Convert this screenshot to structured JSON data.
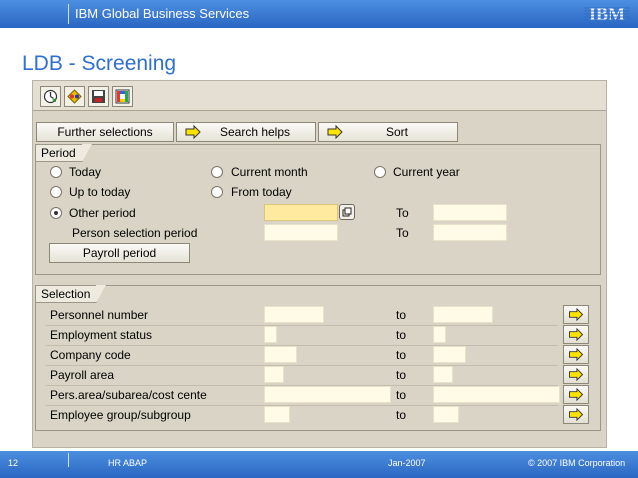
{
  "header": {
    "company": "IBM Global Business Services",
    "logo_text": "IBM"
  },
  "slide_title": "LDB - Screening",
  "toolbar": {
    "icons": [
      "execute-icon",
      "variant-icon",
      "save-icon",
      "selection-options-icon"
    ]
  },
  "buttons": {
    "further_selections": "Further selections",
    "search_helps": "Search helps",
    "sort": "Sort",
    "payroll_period": "Payroll period"
  },
  "period": {
    "group_label": "Period",
    "options": {
      "today": "Today",
      "current_month": "Current month",
      "current_year": "Current year",
      "up_to_today": "Up to today",
      "from_today": "From today",
      "other_period": "Other period"
    },
    "selected": "Other period",
    "person_selection_period": "Person selection period",
    "to_label": "To"
  },
  "selection": {
    "group_label": "Selection",
    "to_label": "to",
    "rows": [
      {
        "label": "Personnel number"
      },
      {
        "label": "Employment status"
      },
      {
        "label": "Company code"
      },
      {
        "label": "Payroll area"
      },
      {
        "label": "Pers.area/subarea/cost cente"
      },
      {
        "label": "Employee group/subgroup"
      }
    ]
  },
  "footer": {
    "page_number": "12",
    "course": "HR ABAP",
    "date": "Jan-2007",
    "copyright": "© 2007 IBM Corporation"
  },
  "colors": {
    "brand_blue": "#2e6fd0",
    "sap_background": "#d9d4c6",
    "input_background": "#fffbe6",
    "focused_input": "#ffeaa0"
  }
}
